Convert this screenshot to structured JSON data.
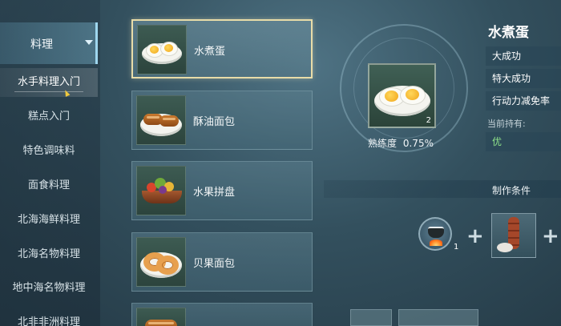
{
  "sidebar": {
    "header_label": "料理",
    "items": [
      {
        "label": "水手料理入门",
        "active": true
      },
      {
        "label": "糕点入门",
        "active": false
      },
      {
        "label": "特色调味料",
        "active": false
      },
      {
        "label": "面食料理",
        "active": false
      },
      {
        "label": "北海海鲜料理",
        "active": false
      },
      {
        "label": "北海名物料理",
        "active": false
      },
      {
        "label": "地中海名物料理",
        "active": false
      },
      {
        "label": "北非非洲料理",
        "active": false
      }
    ]
  },
  "recipes": [
    {
      "name": "水煮蛋",
      "icon": "boiled-egg-icon",
      "selected": true
    },
    {
      "name": "酥油面包",
      "icon": "butter-bread-icon",
      "selected": false
    },
    {
      "name": "水果拼盘",
      "icon": "fruit-platter-icon",
      "selected": false
    },
    {
      "name": "贝果面包",
      "icon": "bagel-icon",
      "selected": false
    }
  ],
  "showcase": {
    "count": "2",
    "proficiency_label": "熟练度",
    "proficiency_value": "0.75%",
    "icon": "boiled-egg-icon"
  },
  "detail": {
    "title": "水煮蛋",
    "outcomes": [
      "大成功",
      "特大成功",
      "行动力减免率"
    ],
    "holding_label": "当前持有:",
    "holding_value": "优",
    "conditions_label": "制作条件",
    "tool_count": "1",
    "tool_icon": "cooking-pot-icon",
    "ingredient_icon": "sausage-meat-icon"
  }
}
